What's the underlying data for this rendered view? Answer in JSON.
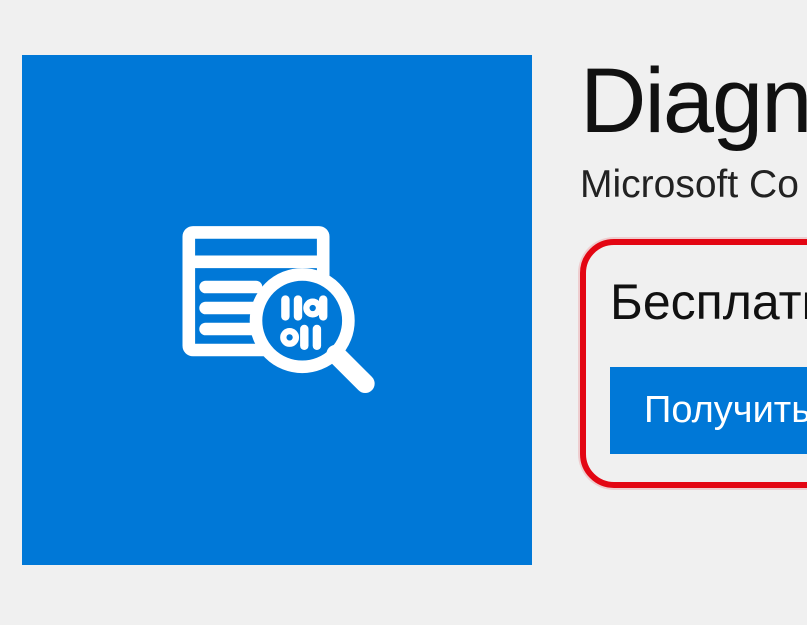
{
  "app": {
    "title": "Diagn",
    "publisher": "Microsoft Co",
    "price_label": "Бесплатн",
    "get_button_label": "Получить",
    "tile_color": "#0078d7"
  }
}
